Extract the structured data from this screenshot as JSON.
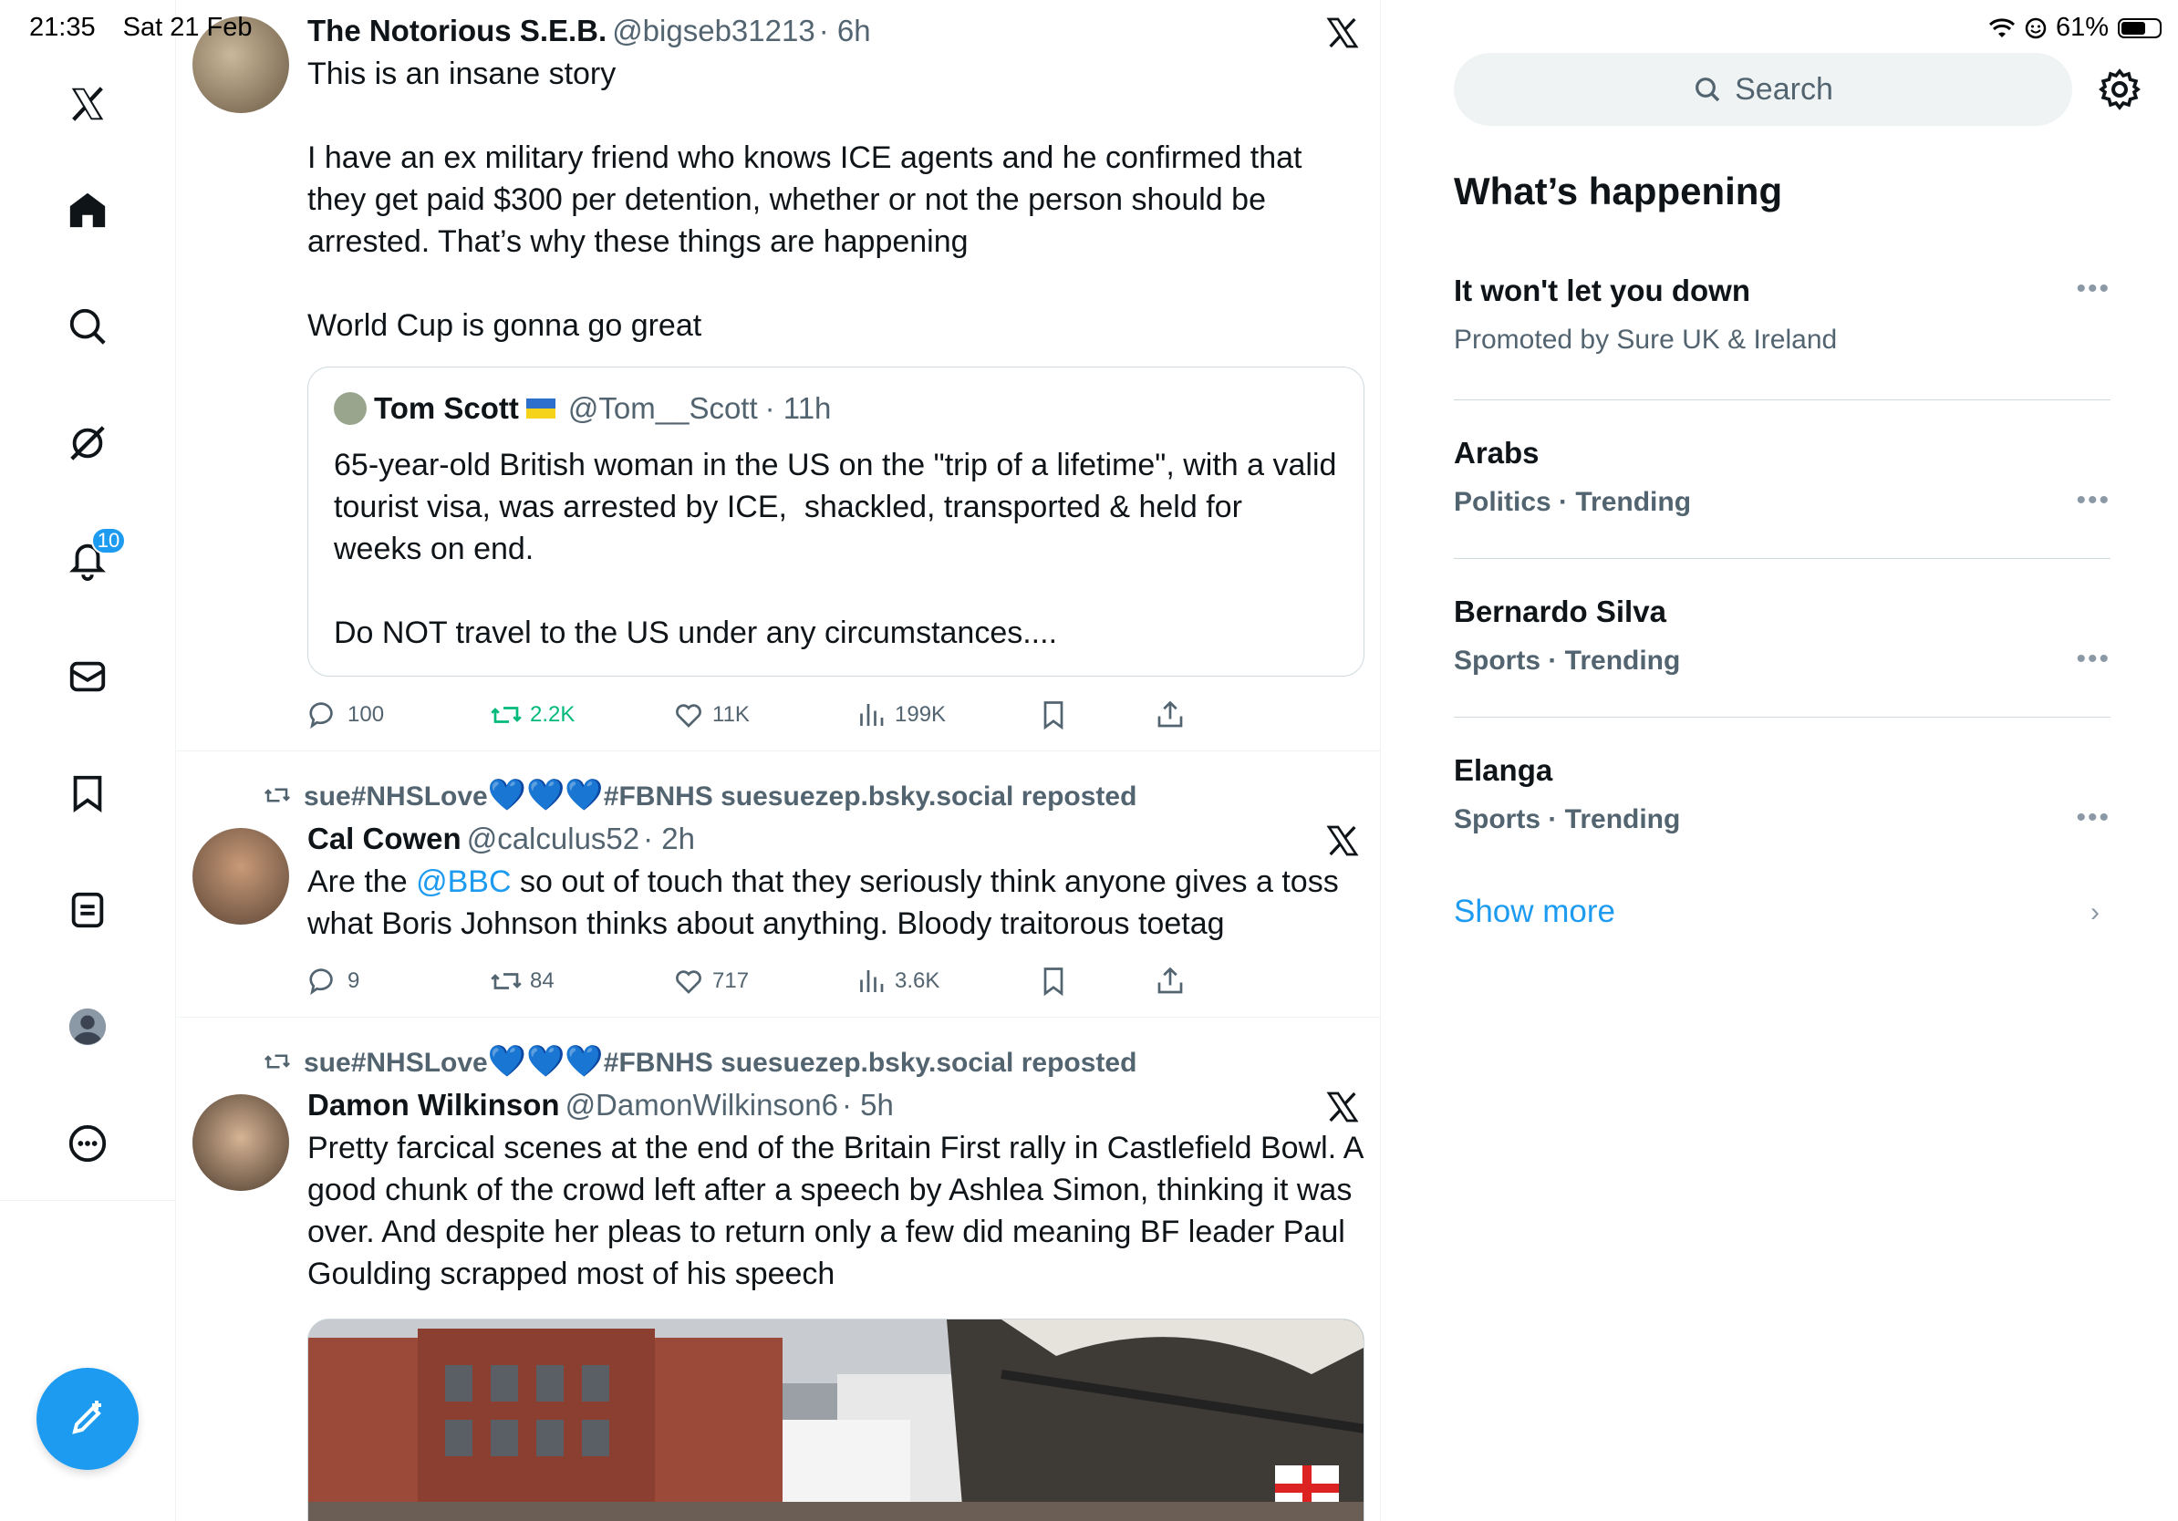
{
  "status_bar": {
    "time": "21:35",
    "date": "Sat 21 Feb",
    "battery": "61%"
  },
  "nav": {
    "notifications_badge": "10",
    "icons": [
      "x-logo-icon",
      "home-icon",
      "search-icon",
      "grok-icon",
      "bell-icon",
      "mail-icon",
      "bookmark-icon",
      "lists-icon",
      "profile-icon",
      "more-icon",
      "compose-icon"
    ]
  },
  "tweets": [
    {
      "name": "The Notorious S.E.B.",
      "handle": "@bigseb31213",
      "time": "· 6h",
      "text": "This is an insane story\n\nI have an ex military friend who knows ICE agents and he confirmed that they get paid $300 per detention, whether or not the person should be arrested. That’s why these things are happening\n\nWorld Cup is gonna go great",
      "quote": {
        "name": "Tom Scott",
        "handle": "@Tom__Scott",
        "time": "· 11h",
        "text": "65-year-old British woman in the US on the \"trip of a lifetime\", with a valid tourist visa, was arrested by ICE,  shackled, transported & held for weeks on end.\n\nDo NOT travel to the US under any circumstances...."
      },
      "replies": "100",
      "reposts": "2.2K",
      "likes": "11K",
      "views": "199K"
    },
    {
      "repost_by_pre": "sue#NHSLove",
      "repost_by_post": "#FBNHS suesuezep.bsky.social reposted",
      "name": "Cal Cowen",
      "handle": "@calculus52",
      "time": "· 2h",
      "text_pre": "Are the ",
      "mention": "@BBC",
      "text_post": " so out of touch that they seriously think anyone gives a toss what Boris Johnson thinks about anything. Bloody traitorous toetag",
      "replies": "9",
      "reposts": "84",
      "likes": "717",
      "views": "3.6K"
    },
    {
      "repost_by_pre": "sue#NHSLove",
      "repost_by_post": "#FBNHS suesuezep.bsky.social reposted",
      "name": "Damon Wilkinson",
      "handle": "@DamonWilkinson6",
      "time": "· 5h",
      "text": "Pretty farcical scenes at the end of the Britain First rally in Castlefield Bowl. A good chunk of the crowd left after a speech by Ashlea Simon, thinking it was over. And despite her pleas to return only a few did meaning BF leader Paul Goulding scrapped most of his speech"
    }
  ],
  "sidebar": {
    "search_placeholder": "Search",
    "title": "What’s happening",
    "trends": [
      {
        "title": "It won't let you down",
        "meta": "Promoted by Sure UK & Ireland"
      },
      {
        "title": "Arabs",
        "meta": "Politics · Trending"
      },
      {
        "title": "Bernardo Silva",
        "meta": "Sports · Trending"
      },
      {
        "title": "Elanga",
        "meta": "Sports · Trending"
      }
    ],
    "show_more": "Show more"
  },
  "colors": {
    "accent": "#1d9bf0",
    "repost_green": "#00ba7c",
    "secondary_text": "#536471"
  }
}
